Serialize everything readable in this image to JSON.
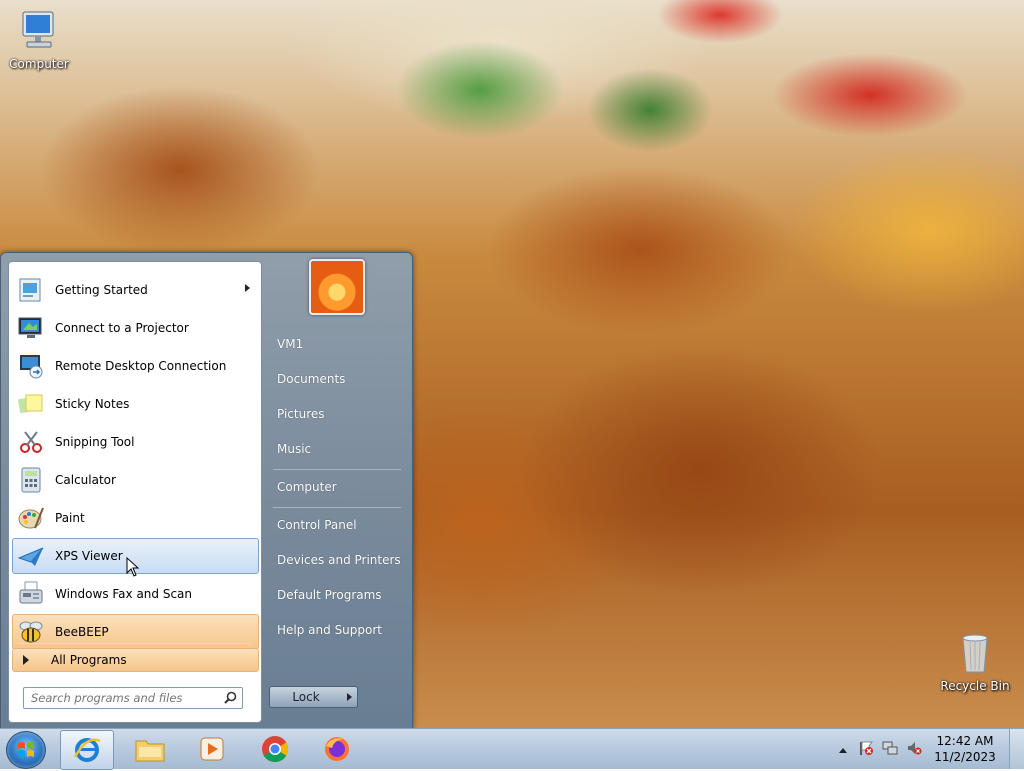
{
  "desktop": {
    "icons": [
      {
        "label": "Computer"
      },
      {
        "label": "Recycle Bin"
      }
    ]
  },
  "start_menu": {
    "programs": [
      {
        "label": "Getting Started",
        "icon": "getting-started-icon",
        "has_submenu": true
      },
      {
        "label": "Connect to a Projector",
        "icon": "projector-icon"
      },
      {
        "label": "Remote Desktop Connection",
        "icon": "remote-desktop-icon"
      },
      {
        "label": "Sticky Notes",
        "icon": "sticky-notes-icon"
      },
      {
        "label": "Snipping Tool",
        "icon": "scissors-icon"
      },
      {
        "label": "Calculator",
        "icon": "calculator-icon"
      },
      {
        "label": "Paint",
        "icon": "paint-palette-icon"
      },
      {
        "label": "XPS Viewer",
        "icon": "xps-viewer-icon",
        "state": "hover"
      },
      {
        "label": "Windows Fax and Scan",
        "icon": "fax-icon"
      },
      {
        "label": "BeeBEEP",
        "icon": "bee-icon",
        "state": "pinned"
      }
    ],
    "all_programs_label": "All Programs",
    "search_placeholder": "Search programs and files",
    "right_items": [
      "VM1",
      "Documents",
      "Pictures",
      "Music",
      "Computer",
      "Control Panel",
      "Devices and Printers",
      "Default Programs",
      "Help and Support"
    ],
    "lock_label": "Lock"
  },
  "taskbar": {
    "pinned": [
      "internet-explorer-icon",
      "file-explorer-icon",
      "media-player-icon",
      "chrome-icon",
      "firefox-icon"
    ],
    "clock_time": "12:42 AM",
    "clock_date": "11/2/2023"
  },
  "colors": {
    "hover": "#c7dcf2",
    "pinned": "#f6c68b",
    "taskbar": "#b9cbdf"
  }
}
